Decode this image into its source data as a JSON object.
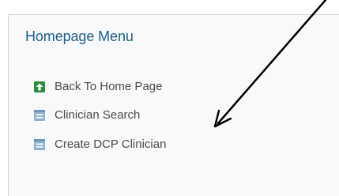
{
  "menu_panel": {
    "title": "Homepage Menu",
    "items": [
      {
        "label": "Back To Home Page",
        "icon": "home-up-icon"
      },
      {
        "label": "Clinician Search",
        "icon": "list-doc-icon"
      },
      {
        "label": "Create DCP Clinician",
        "icon": "list-doc-icon"
      }
    ]
  },
  "colors": {
    "title": "#1f5f8a",
    "item_text": "#4a4a4a",
    "home_icon": "#2e8b3e",
    "doc_icon": "#8fb3cf",
    "panel_bg": "#f8f9fa",
    "annotation_arrow": "#000000"
  }
}
